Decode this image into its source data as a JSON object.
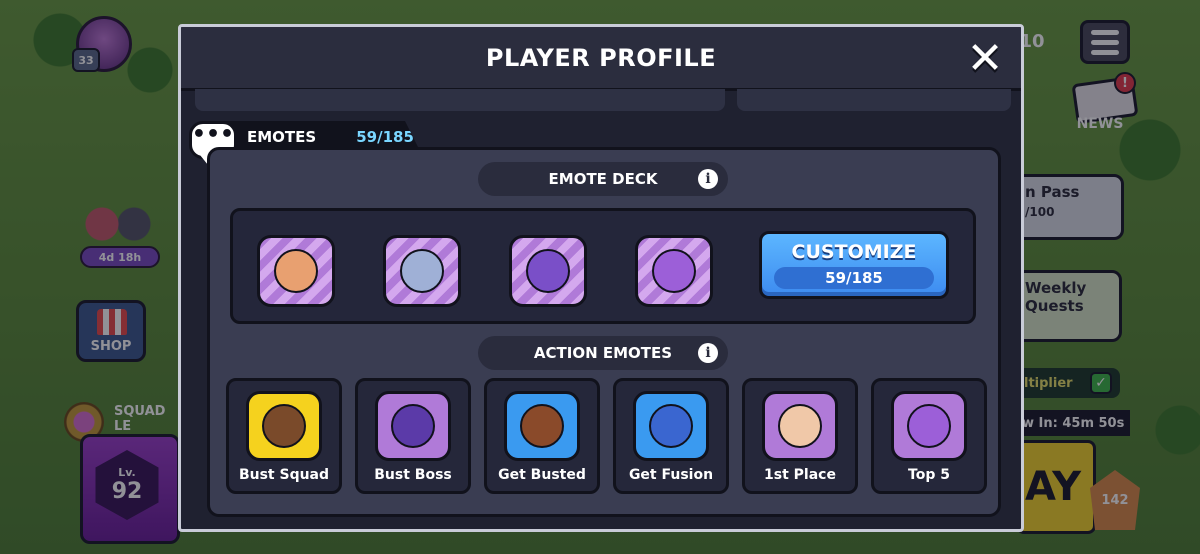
{
  "hud": {
    "player_level": "33",
    "squad_timer": "4d 18h",
    "shop_label": "SHOP",
    "squad_league_label": "SQUAD LE",
    "league_level_prefix": "Lv.",
    "league_level": "92",
    "top_count": "10",
    "news_label": "NEWS",
    "news_badge": "!",
    "pass_label": "n Pass",
    "pass_progress": "/100",
    "quests_label_1": "Weekly",
    "quests_label_2": "Quests",
    "multiplier_label": "ltiplier",
    "new_in_label": "w In: 45m 50s",
    "play_label": "AY",
    "trophy_count": "142"
  },
  "modal": {
    "title": "PLAYER PROFILE",
    "close_glyph": "✕",
    "tab": {
      "label": "EMOTES",
      "count": "59/185"
    },
    "emote_deck": {
      "title": "EMOTE DECK",
      "info_glyph": "i",
      "emotes": [
        {
          "icon": "witch-hat-emote-icon",
          "color": "#e8a070"
        },
        {
          "icon": "crowned-king-emote-icon",
          "color": "#9fb0d6"
        },
        {
          "icon": "purple-bird-emote-icon",
          "color": "#7a4fc8"
        },
        {
          "icon": "heart-eyes-emote-icon",
          "color": "#9c5fd8"
        }
      ],
      "customize_label": "CUSTOMIZE",
      "customize_count": "59/185"
    },
    "action_emotes": {
      "title": "ACTION EMOTES",
      "info_glyph": "i",
      "items": [
        {
          "label": "Bust Squad",
          "bg": "#f5d21e",
          "face": "#7a4a2a",
          "icon": "bust-squad-emote-icon"
        },
        {
          "label": "Bust Boss",
          "bg": "#b07ad8",
          "face": "#5b3aa8",
          "icon": "bust-boss-emote-icon"
        },
        {
          "label": "Get Busted",
          "bg": "#3a9af0",
          "face": "#8a4a2a",
          "icon": "get-busted-emote-icon"
        },
        {
          "label": "Get Fusion",
          "bg": "#3a9af0",
          "face": "#3a66d0",
          "icon": "get-fusion-emote-icon"
        },
        {
          "label": "1st Place",
          "bg": "#b07ad8",
          "face": "#f0c8a8",
          "icon": "first-place-emote-icon"
        },
        {
          "label": "Top 5",
          "bg": "#b07ad8",
          "face": "#9c5fd8",
          "icon": "top-five-emote-icon"
        }
      ]
    }
  }
}
